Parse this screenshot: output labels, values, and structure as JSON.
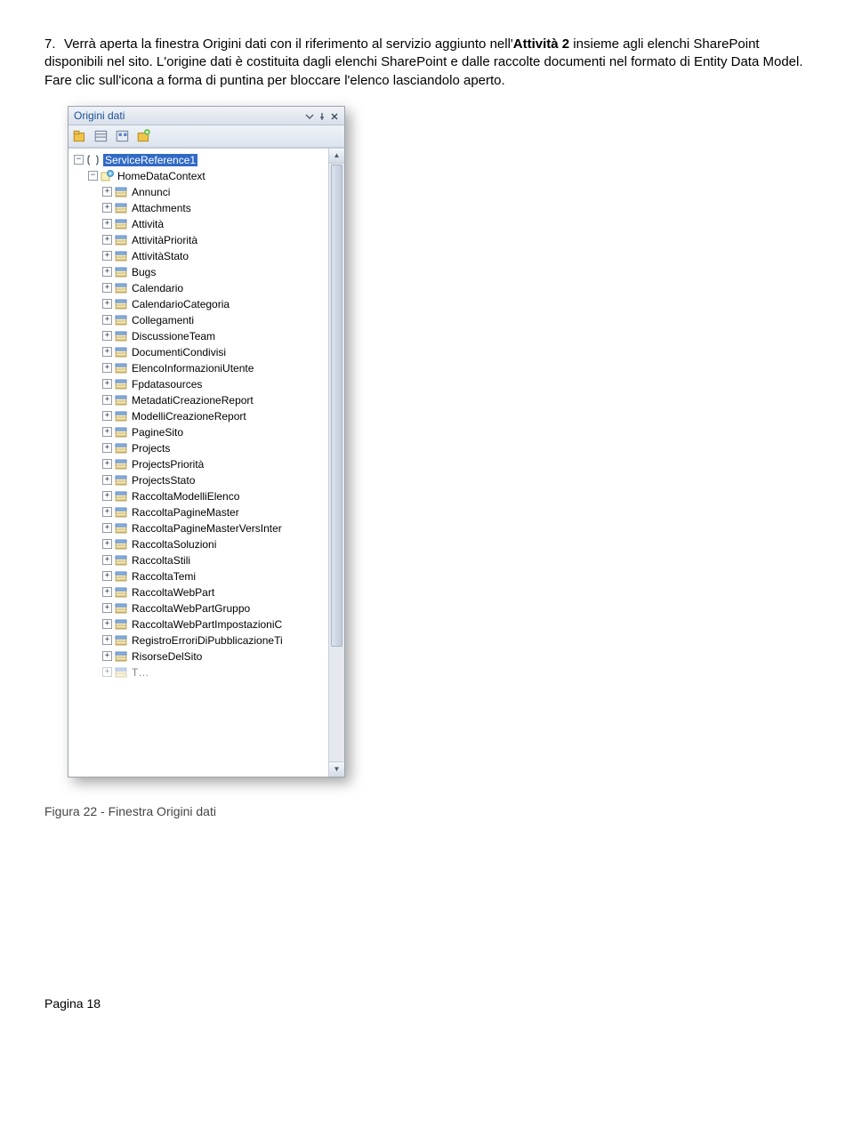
{
  "intro": {
    "number": "7.",
    "text_a": "Verrà aperta la finestra Origini dati con il riferimento al servizio aggiunto nell'",
    "bold": "Attività 2",
    "text_b": " insieme agli elenchi SharePoint disponibili nel sito. L'origine dati è costituita dagli elenchi SharePoint e dalle raccolte documenti nel formato di Entity Data Model. Fare clic sull'icona a forma di puntina per bloccare l'elenco lasciandolo aperto."
  },
  "panel": {
    "title": "Origini dati",
    "root": {
      "label": "ServiceReference1",
      "context": {
        "label": "HomeDataContext",
        "items": [
          "Annunci",
          "Attachments",
          "Attività",
          "AttivitàPriorità",
          "AttivitàStato",
          "Bugs",
          "Calendario",
          "CalendarioCategoria",
          "Collegamenti",
          "DiscussioneTeam",
          "DocumentiCondivisi",
          "ElencoInformazioniUtente",
          "Fpdatasources",
          "MetadatiCreazioneReport",
          "ModelliCreazioneReport",
          "PagineSito",
          "Projects",
          "ProjectsPriorità",
          "ProjectsStato",
          "RaccoltaModelliElenco",
          "RaccoltaPagineMaster",
          "RaccoltaPagineMasterVersInter",
          "RaccoltaSoluzioni",
          "RaccoltaStili",
          "RaccoltaTemi",
          "RaccoltaWebPart",
          "RaccoltaWebPartGruppo",
          "RaccoltaWebPartImpostazioniC",
          "RegistroErroriDiPubblicazioneTi",
          "RisorseDelSito"
        ]
      }
    }
  },
  "caption": "Figura 22 - Finestra Origini dati",
  "footer": "Pagina 18"
}
